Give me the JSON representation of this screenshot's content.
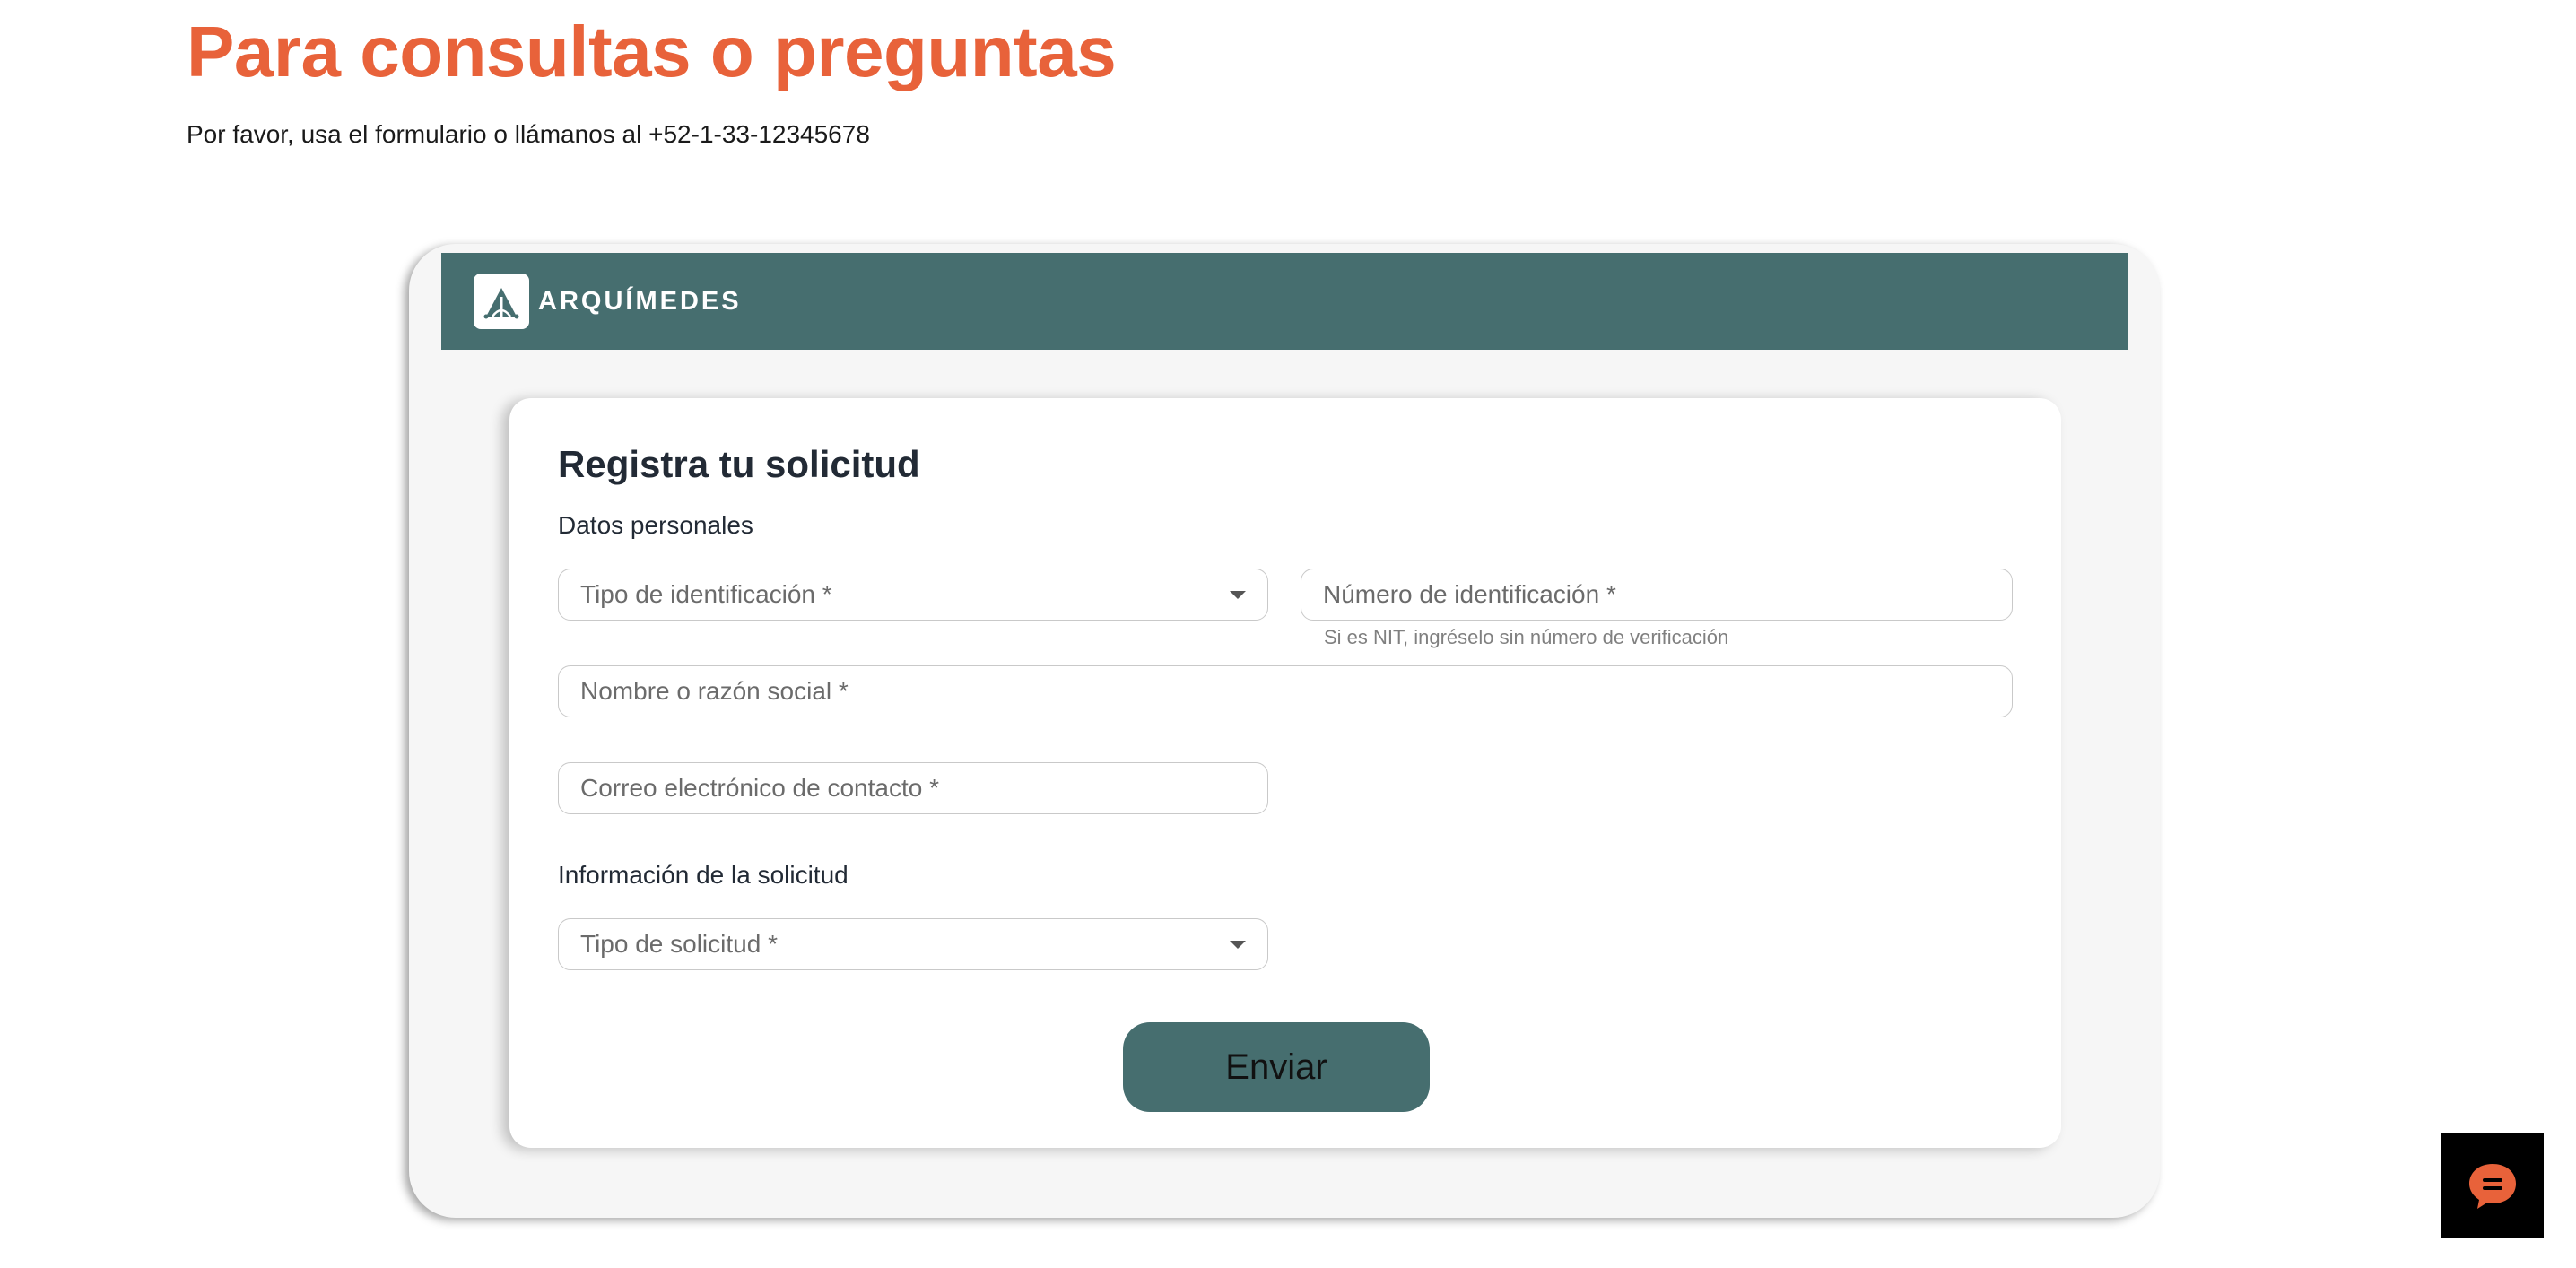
{
  "hero": {
    "title": "Para consultas o preguntas",
    "subtitle": "Por favor, usa el formulario o llámanos al +52-1-33-12345678"
  },
  "brand": {
    "name": "ARQUÍMEDES",
    "bar_color": "#466e6f",
    "logo_icon": "arch-logo-icon"
  },
  "form": {
    "title": "Registra tu solicitud",
    "sections": {
      "personal": "Datos personales",
      "request": "Información de la solicitud"
    },
    "fields": {
      "id_type": {
        "placeholder": "Tipo de identificación *",
        "kind": "select"
      },
      "id_number": {
        "placeholder": "Número de identificación  *",
        "kind": "input",
        "helper": "Si es NIT, ingréselo sin número de verificación"
      },
      "name": {
        "placeholder": "Nombre o razón social *",
        "kind": "input"
      },
      "email": {
        "placeholder": "Correo electrónico de contacto *",
        "kind": "input"
      },
      "request_type": {
        "placeholder": "Tipo de solicitud *",
        "kind": "select"
      }
    },
    "submit_label": "Enviar"
  },
  "chat": {
    "icon": "chat-bubble-icon",
    "accent": "#e8623a"
  },
  "colors": {
    "hero_title": "#e8623a",
    "primary": "#466e6f"
  }
}
